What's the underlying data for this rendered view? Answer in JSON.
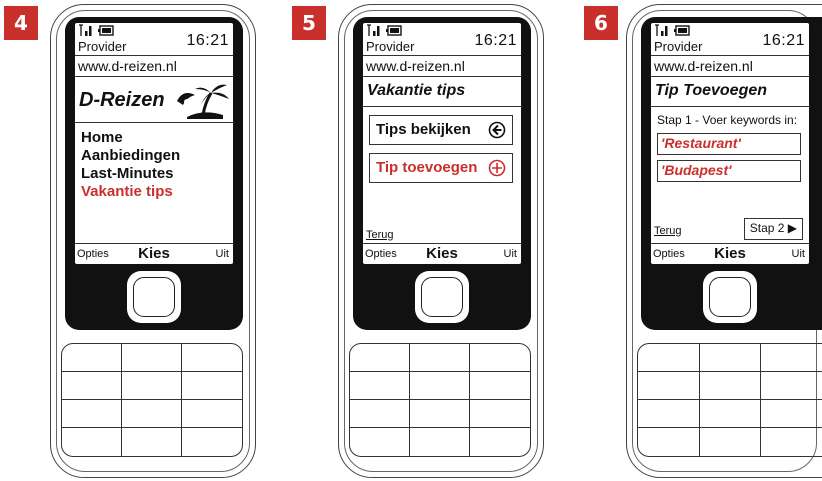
{
  "frames": [
    {
      "step": "4",
      "provider": "Provider",
      "time": "16:21",
      "url": "www.d-reizen.nl",
      "logo_text": "D-Reizen",
      "menu": [
        "Home",
        "Aanbiedingen",
        "Last-Minutes",
        "Vakantie tips"
      ],
      "active_menu_item": "Vakantie tips",
      "softkeys": {
        "left": "Opties",
        "middle": "Kies",
        "right": "Uit"
      }
    },
    {
      "step": "5",
      "provider": "Provider",
      "time": "16:21",
      "url": "www.d-reizen.nl",
      "title": "Vakantie tips",
      "buttons": [
        {
          "label": "Tips bekijken",
          "icon": "arrow-left-circle-icon"
        },
        {
          "label": "Tip toevoegen",
          "icon": "plus-circle-icon"
        }
      ],
      "back_link": "Terug",
      "softkeys": {
        "left": "Opties",
        "middle": "Kies",
        "right": "Uit"
      }
    },
    {
      "step": "6",
      "provider": "Provider",
      "time": "16:21",
      "url": "www.d-reizen.nl",
      "title": "Tip Toevoegen",
      "instruction": "Stap 1 - Voer keywords in:",
      "keywords": [
        "'Restaurant'",
        "'Budapest'"
      ],
      "back_link": "Terug",
      "next_button": "Stap 2 ▶",
      "softkeys": {
        "left": "Opties",
        "middle": "Kies",
        "right": "Uit"
      }
    }
  ],
  "colors": {
    "badge": "#c9302c",
    "highlight": "#c9302c",
    "bezel": "#111111"
  }
}
